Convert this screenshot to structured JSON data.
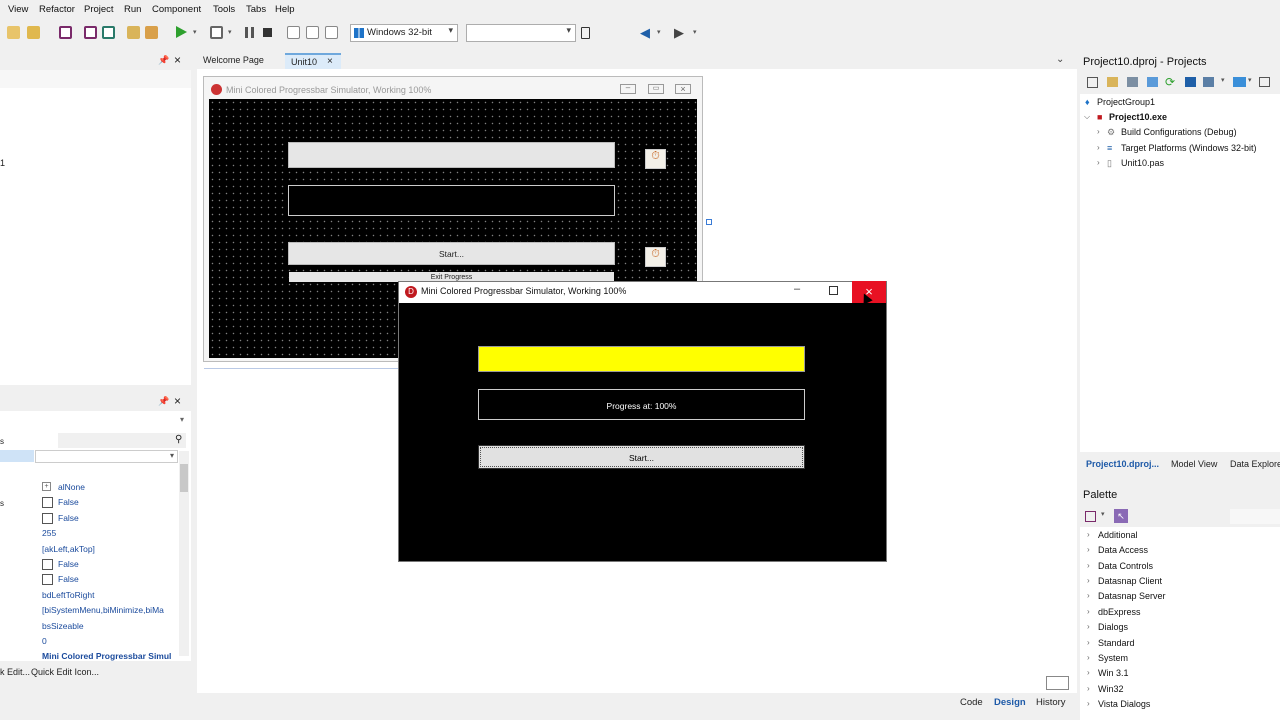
{
  "menu": [
    "View",
    "Refactor",
    "Project",
    "Run",
    "Component",
    "Tools",
    "Tabs",
    "Help"
  ],
  "toolbar": {
    "platform": "Windows 32-bit",
    "config": ""
  },
  "left": {
    "marker": "1",
    "props_marker": "s",
    "props_marker2": "s",
    "properties": [
      "alNone",
      "False",
      "False",
      "255",
      "[akLeft,akTop]",
      "False",
      "False",
      "bdLeftToRight",
      "[biSystemMenu,biMinimize,biMa",
      "bsSizeable",
      "0",
      "Mini Colored Progressbar Simul"
    ],
    "quick_edit": "k Edit...",
    "quick_edit_icon": "Quick Edit Icon..."
  },
  "editor": {
    "tabs": [
      "Welcome Page",
      "Unit10"
    ],
    "bottom_tabs": [
      "Code",
      "Design",
      "History"
    ]
  },
  "designer": {
    "title": "Mini Colored Progressbar Simulator, Working 100%",
    "start_label": "Start...",
    "exit_label": "Exit Progress"
  },
  "app": {
    "title": "Mini Colored Progressbar Simulator, Working 100%",
    "progress_fraction": 1.0,
    "bar_color": "#ffff00",
    "progress_text": "Progress at: 100%",
    "start_label": "Start..."
  },
  "projects": {
    "title": "Project10.dproj - Projects",
    "group": "ProjectGroup1",
    "exe": "Project10.exe",
    "items": [
      "Build Configurations (Debug)",
      "Target Platforms (Windows 32-bit)",
      "Unit10.pas"
    ],
    "tabs": [
      "Project10.dproj...",
      "Model View",
      "Data Explorer"
    ]
  },
  "palette": {
    "title": "Palette",
    "items": [
      "Additional",
      "Data Access",
      "Data Controls",
      "Datasnap Client",
      "Datasnap Server",
      "dbExpress",
      "Dialogs",
      "Standard",
      "System",
      "Win 3.1",
      "Win32",
      "Vista Dialogs"
    ]
  }
}
